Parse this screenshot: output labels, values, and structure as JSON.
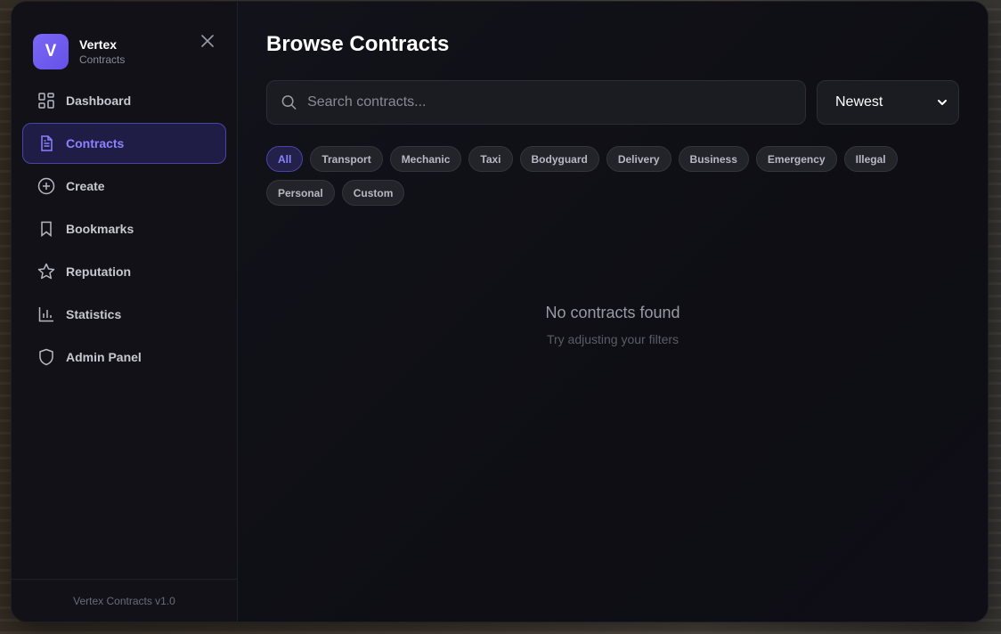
{
  "brand": {
    "initial": "V",
    "name": "Vertex",
    "subtitle": "Contracts"
  },
  "sidebar": {
    "items": [
      {
        "label": "Dashboard",
        "icon": "grid-icon",
        "active": false
      },
      {
        "label": "Contracts",
        "icon": "document-icon",
        "active": true
      },
      {
        "label": "Create",
        "icon": "plus-circle-icon",
        "active": false
      },
      {
        "label": "Bookmarks",
        "icon": "bookmark-icon",
        "active": false
      },
      {
        "label": "Reputation",
        "icon": "star-icon",
        "active": false
      },
      {
        "label": "Statistics",
        "icon": "bar-chart-icon",
        "active": false
      },
      {
        "label": "Admin Panel",
        "icon": "shield-icon",
        "active": false
      }
    ],
    "footer": "Vertex Contracts v1.0"
  },
  "main": {
    "title": "Browse Contracts",
    "search": {
      "placeholder": "Search contracts...",
      "value": ""
    },
    "sort": {
      "selected": "Newest"
    },
    "filters": [
      "All",
      "Transport",
      "Mechanic",
      "Taxi",
      "Bodyguard",
      "Delivery",
      "Business",
      "Emergency",
      "Illegal",
      "Personal",
      "Custom"
    ],
    "active_filter": "All",
    "empty": {
      "title": "No contracts found",
      "subtitle": "Try adjusting your filters"
    }
  },
  "colors": {
    "accent": "#6b57ee",
    "accent_text": "#8c82ff",
    "bg": "#101016"
  }
}
